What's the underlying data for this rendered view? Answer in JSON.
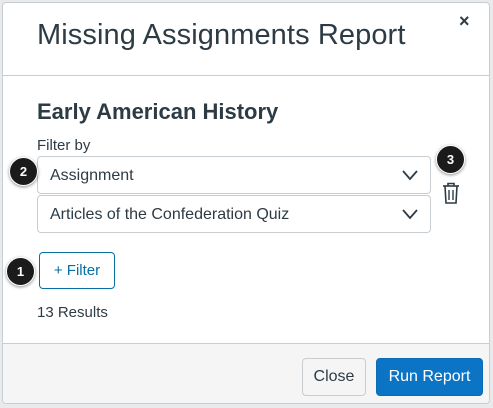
{
  "modal": {
    "title": "Missing Assignments Report",
    "close_symbol": "×"
  },
  "course": {
    "title": "Early American History"
  },
  "filters": {
    "label": "Filter by",
    "type_select": {
      "value": "Assignment",
      "icon": "chevron-down-icon"
    },
    "value_select": {
      "value": "Articles of the Confederation Quiz",
      "icon": "chevron-down-icon"
    },
    "delete_icon": "trash-icon",
    "add_filter_label": "+ Filter"
  },
  "results": {
    "text": "13 Results"
  },
  "footer": {
    "close_label": "Close",
    "run_label": "Run Report"
  },
  "callouts": [
    "1",
    "2",
    "3"
  ],
  "colors": {
    "text": "#2d3b45",
    "link": "#0770a3",
    "primary": "#0b74c5",
    "border": "#c7cdd1",
    "footer_bg": "#f5f5f5"
  }
}
